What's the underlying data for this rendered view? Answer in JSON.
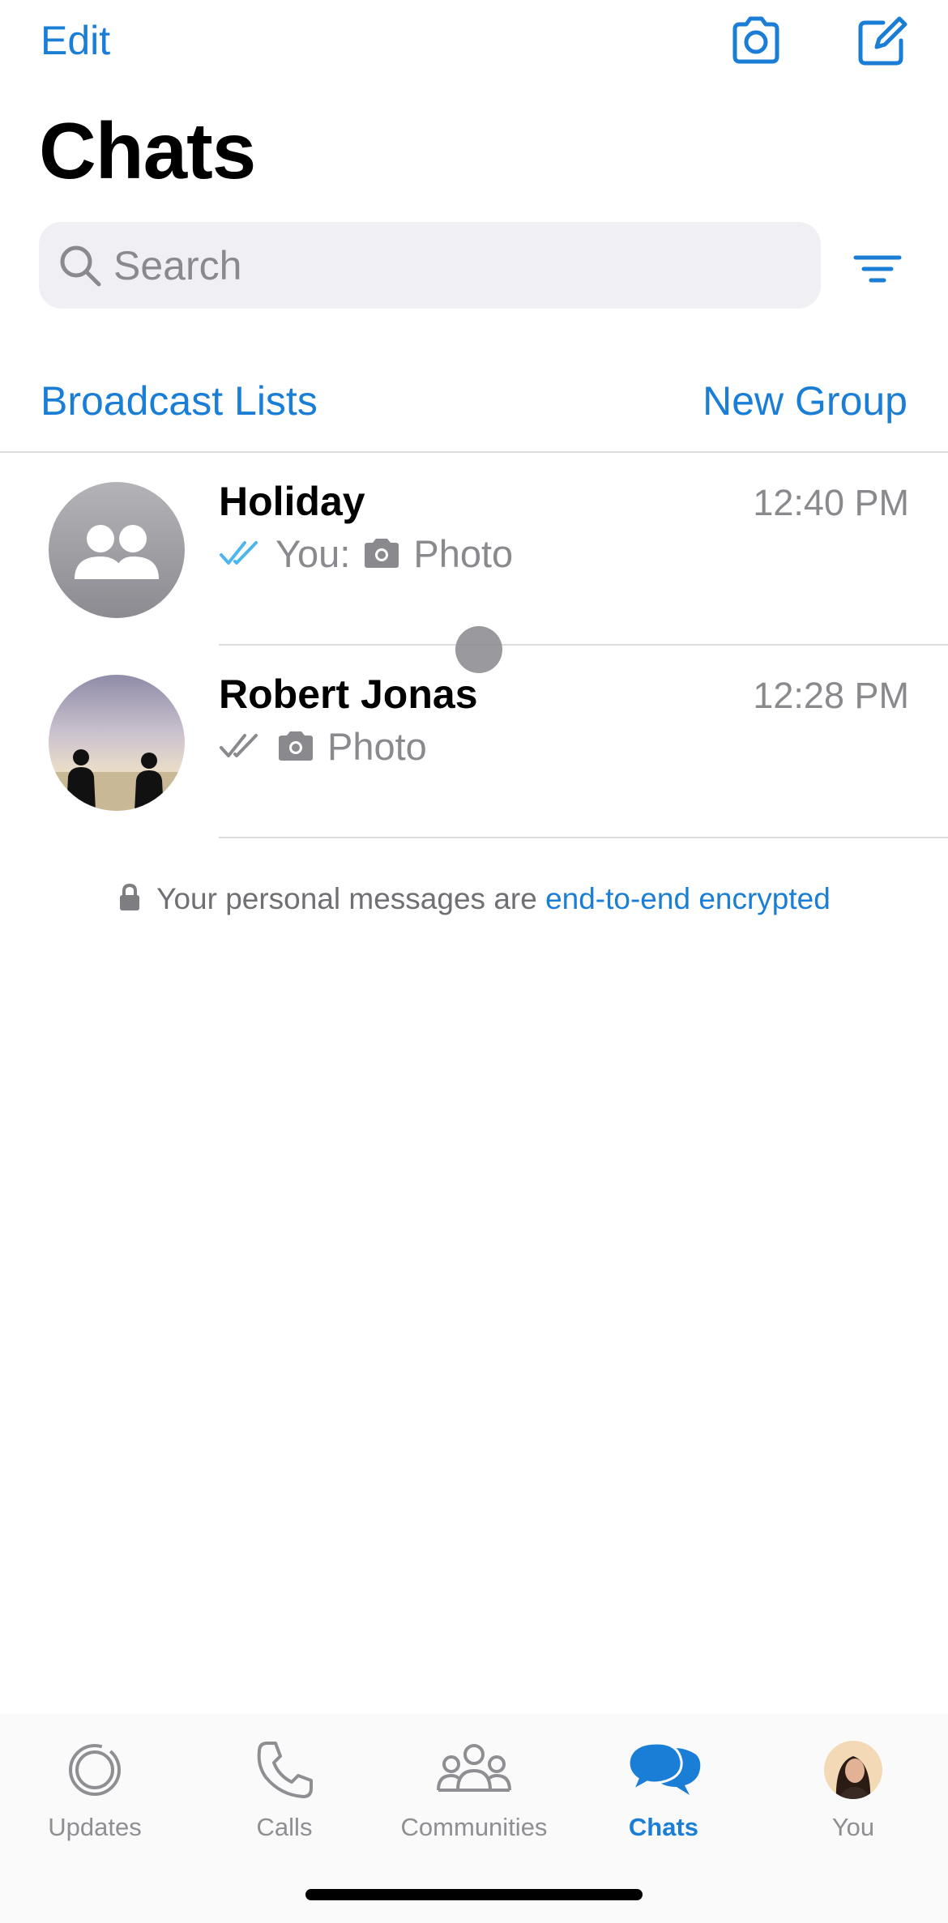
{
  "header": {
    "edit_label": "Edit",
    "title": "Chats",
    "camera_icon": "camera-icon",
    "compose_icon": "compose-icon"
  },
  "search": {
    "placeholder": "Search",
    "value": "",
    "filter_icon": "filter-icon"
  },
  "links": {
    "broadcast": "Broadcast Lists",
    "new_group": "New Group"
  },
  "chats": [
    {
      "name": "Holiday",
      "time": "12:40 PM",
      "sender_prefix": "You:",
      "preview": "Photo",
      "read_status": "read",
      "avatar": "group-avatar"
    },
    {
      "name": "Robert Jonas",
      "time": "12:28 PM",
      "sender_prefix": "",
      "preview": "Photo",
      "read_status": "delivered",
      "avatar": "photo-avatar"
    }
  ],
  "encryption": {
    "text": "Your personal messages are ",
    "link": "end-to-end encrypted"
  },
  "tabs": [
    {
      "label": "Updates",
      "icon": "updates-icon",
      "active": false
    },
    {
      "label": "Calls",
      "icon": "phone-icon",
      "active": false
    },
    {
      "label": "Communities",
      "icon": "communities-icon",
      "active": false
    },
    {
      "label": "Chats",
      "icon": "chats-icon",
      "active": true
    },
    {
      "label": "You",
      "icon": "profile-avatar",
      "active": false
    }
  ],
  "colors": {
    "accent": "#1b7ed6",
    "read_ticks": "#4fb6ec",
    "secondary_text": "#8a8a8e",
    "search_bg": "#f0eff4"
  }
}
